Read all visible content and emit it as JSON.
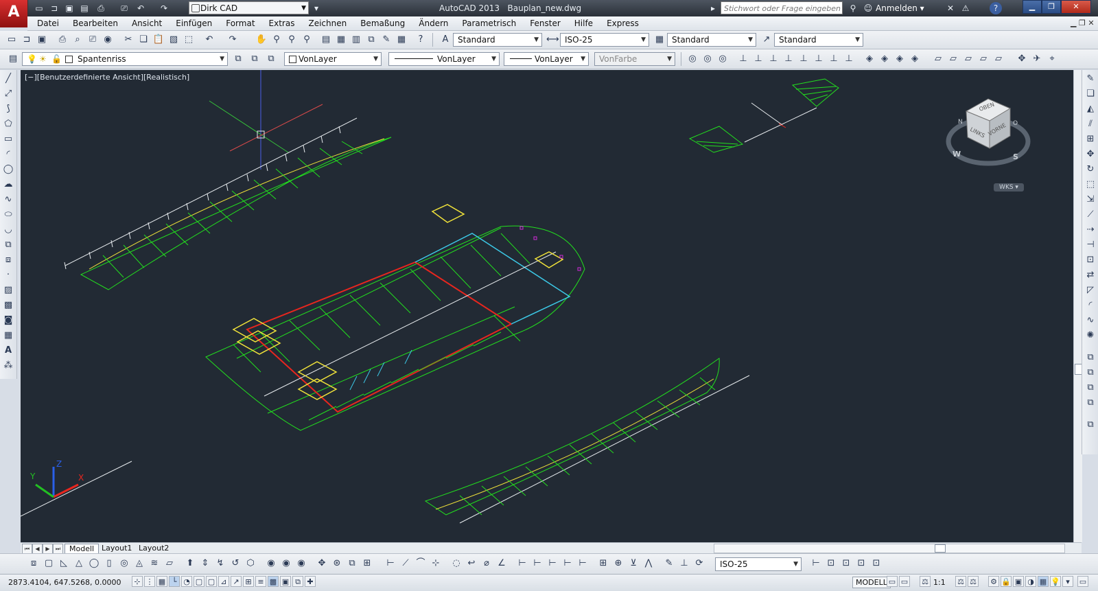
{
  "app": {
    "logo_letter": "A",
    "title": "AutoCAD 2013",
    "filename": "Bauplan_new.dwg",
    "workspace": "Dirk CAD",
    "search_placeholder": "Stichwort oder Frage eingeben",
    "signin_label": "Anmelden",
    "help_label": "?"
  },
  "menu": [
    "Datei",
    "Bearbeiten",
    "Ansicht",
    "Einfügen",
    "Format",
    "Extras",
    "Zeichnen",
    "Bemaßung",
    "Ändern",
    "Parametrisch",
    "Fenster",
    "Hilfe",
    "Express"
  ],
  "styles_toolbar": {
    "text_style": "Standard",
    "dim_style": "ISO-25",
    "table_style": "Standard",
    "multileader_style": "Standard"
  },
  "layers_toolbar": {
    "current_layer": "Spantenriss",
    "color": "VonLayer",
    "linetype": "VonLayer",
    "lineweight": "VonLayer",
    "plotstyle": "VonFarbe"
  },
  "viewport": {
    "label": "[−][Benutzerdefinierte Ansicht][Realistisch]",
    "background": "#222a34"
  },
  "viewcube": {
    "top": "OBEN",
    "left": "LINKS",
    "front": "VORNE",
    "west": "W",
    "south": "S",
    "north": "N",
    "east": "O",
    "ucs_menu": "WKS"
  },
  "ucs_icon": {
    "x": "X",
    "y": "Y",
    "z": "Z"
  },
  "tabs": [
    {
      "label": "Modell",
      "active": true
    },
    {
      "label": "Layout1",
      "active": false
    },
    {
      "label": "Layout2",
      "active": false
    }
  ],
  "bottom_toolbar": {
    "dim_style": "ISO-25"
  },
  "status": {
    "coordinates": "2873.4104, 647.5268, 0.0000",
    "space": "MODELL",
    "annotation_scale": "1:1"
  },
  "colors": {
    "green": "#22e01e",
    "yellow": "#f0e23a",
    "red": "#e8261e",
    "cyan": "#3cc8e6",
    "magenta": "#d02ad8",
    "white": "#e8ecef"
  }
}
